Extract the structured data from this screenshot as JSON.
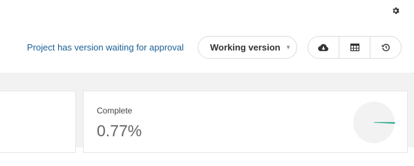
{
  "header": {
    "settings_icon": "gear-icon",
    "approval_notice": "Project has version waiting for approval",
    "version_selector": {
      "selected": "Working version"
    },
    "actions": [
      {
        "name": "download",
        "icon": "cloud-download-icon"
      },
      {
        "name": "table-view",
        "icon": "table-icon"
      },
      {
        "name": "history",
        "icon": "history-icon"
      }
    ]
  },
  "cards": {
    "complete": {
      "label": "Complete",
      "value": "0.77%",
      "progress": 0.0077
    }
  },
  "colors": {
    "link": "#1b5f94",
    "progress_fill": "#1fa58a",
    "pie_bg": "#f2f2f2"
  }
}
